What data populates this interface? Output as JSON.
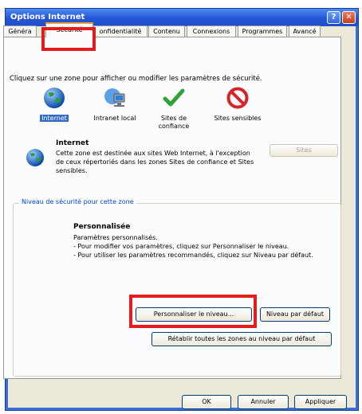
{
  "window": {
    "title": "Options Internet",
    "help_label": "?",
    "close_label": "✕"
  },
  "tabs": [
    {
      "label": "Généra"
    },
    {
      "label": "Sécurité"
    },
    {
      "label": "onfidentialité"
    },
    {
      "label": "Contenu"
    },
    {
      "label": "Connexions"
    },
    {
      "label": "Programmes"
    },
    {
      "label": "Avancé"
    }
  ],
  "active_tab": "Sécurité",
  "instruction": "Cliquez sur une zone pour afficher ou modifier les paramètres de sécurité.",
  "zones": [
    {
      "label": "Internet",
      "icon": "globe-icon",
      "selected": true
    },
    {
      "label": "Intranet local",
      "icon": "network-computer-icon",
      "selected": false
    },
    {
      "label": "Sites de confiance",
      "icon": "checkmark-icon",
      "selected": false
    },
    {
      "label": "Sites sensibles",
      "icon": "no-entry-icon",
      "selected": false
    }
  ],
  "zone_info": {
    "title": "Internet",
    "description": "Cette zone est destinée aux sites Web Internet, à l'exception de ceux répertoriés dans les zones Sites de confiance et Sites sensibles.",
    "sites_button": "Sites"
  },
  "security_level": {
    "group_label": "Niveau de sécurité pour cette zone",
    "title": "Personnalisée",
    "lines": [
      "Paramètres personnalisés.",
      "- Pour modifier vos paramètres, cliquez sur Personnaliser le niveau.",
      "- Pour utiliser les paramètres recommandés, cliquez sur Niveau par défaut."
    ],
    "custom_button": "Personnaliser le niveau...",
    "default_button": "Niveau par défaut",
    "reset_button": "Rétablir toutes les zones au niveau par défaut"
  },
  "footer": {
    "ok": "OK",
    "cancel": "Annuler",
    "apply": "Appliquer"
  },
  "colors": {
    "highlight": "#e31c1c",
    "titlebar": "#2455d6",
    "selection": "#316ac5"
  }
}
